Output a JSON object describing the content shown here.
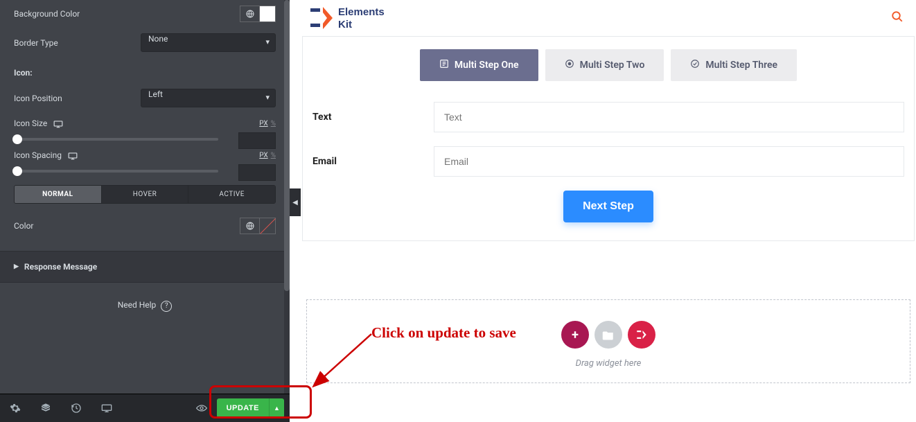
{
  "sidebar": {
    "bg_color_label": "Background Color",
    "border_type_label": "Border Type",
    "border_type_value": "None",
    "icon_section": "Icon:",
    "icon_position_label": "Icon Position",
    "icon_position_value": "Left",
    "icon_size_label": "Icon Size",
    "icon_spacing_label": "Icon Spacing",
    "unit_px": "PX",
    "unit_pct": "%",
    "tabs": {
      "normal": "NORMAL",
      "hover": "HOVER",
      "active": "ACTIVE"
    },
    "color_label": "Color",
    "accordion_response": "Response Message",
    "need_help": "Need Help",
    "update_btn": "UPDATE"
  },
  "canvas": {
    "logo_top": "Elements",
    "logo_bottom": "Kit",
    "steps": [
      {
        "label": "Multi Step One"
      },
      {
        "label": "Multi Step Two"
      },
      {
        "label": "Multi Step Three"
      }
    ],
    "fields": {
      "text_label": "Text",
      "text_placeholder": "Text",
      "email_label": "Email",
      "email_placeholder": "Email"
    },
    "next_btn": "Next Step",
    "drag_text": "Drag widget here"
  },
  "annotation": "Click on update to save"
}
